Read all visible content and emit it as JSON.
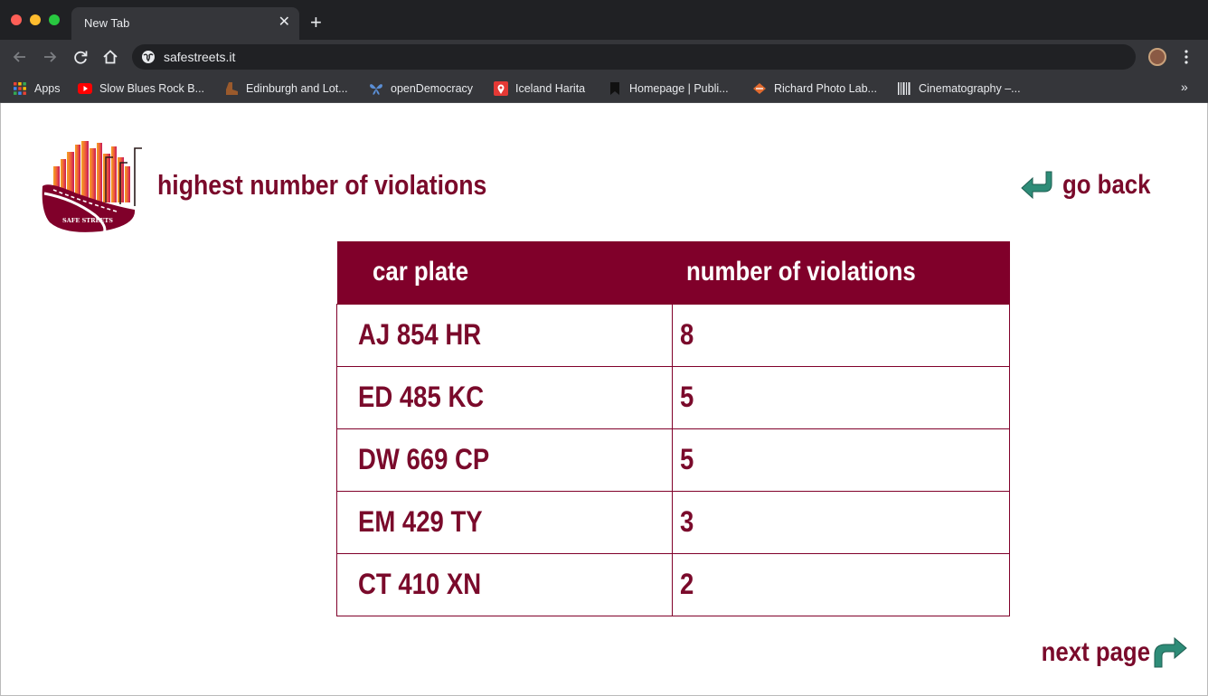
{
  "browser": {
    "tab_title": "New Tab",
    "tab_close": "✕",
    "new_tab": "+",
    "url": "safestreets.it",
    "bookmarks": [
      {
        "label": "Apps",
        "icon": "apps-grid-icon"
      },
      {
        "label": "Slow Blues Rock B...",
        "icon": "youtube-icon"
      },
      {
        "label": "Edinburgh and Lot...",
        "icon": "boot-icon"
      },
      {
        "label": "openDemocracy",
        "icon": "butterfly-icon"
      },
      {
        "label": "Iceland Harita",
        "icon": "map-pin-icon"
      },
      {
        "label": "Homepage | Publi...",
        "icon": "bookmark-icon"
      },
      {
        "label": "Richard Photo Lab...",
        "icon": "diamond-icon"
      },
      {
        "label": "Cinematography –...",
        "icon": "barcode-icon"
      }
    ],
    "bookmarks_more": "»"
  },
  "page": {
    "logo_text": "SAFE STREETS",
    "heading": "highest number of violations",
    "go_back_label": "go back",
    "next_page_label": "next page",
    "table": {
      "headers": [
        "car plate",
        "number of violations"
      ],
      "rows": [
        [
          "AJ 854 HR",
          "8"
        ],
        [
          "ED 485 KC",
          "5"
        ],
        [
          "DW 669 CP",
          "5"
        ],
        [
          "EM 429 TY",
          "3"
        ],
        [
          "CT 410 XN",
          "2"
        ]
      ]
    },
    "colors": {
      "brand": "#80002a",
      "icon_teal": "#2e8c78"
    }
  }
}
